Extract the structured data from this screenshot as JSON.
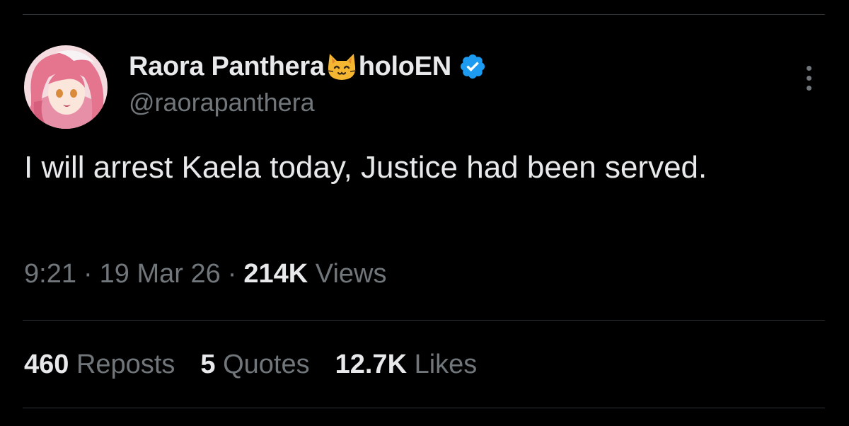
{
  "tweet": {
    "author": {
      "name_part1": "Raora Panthera",
      "emoji": "cat-face-emoji",
      "name_part2": "holoEN",
      "verified": true,
      "handle": "@raorapanthera",
      "avatar": "avatar-image"
    },
    "text": "I will arrest Kaela today, Justice had been served.",
    "meta": {
      "time": "9:21",
      "separator": "·",
      "date": "19 Mar 26",
      "views_count": "214K",
      "views_label": "Views"
    },
    "stats": [
      {
        "count": "460",
        "label": "Reposts"
      },
      {
        "count": "5",
        "label": "Quotes"
      },
      {
        "count": "12.7K",
        "label": "Likes"
      }
    ]
  },
  "colors": {
    "background": "#000000",
    "text_primary": "#e7e9ea",
    "text_secondary": "#71767b",
    "divider": "#2f3336",
    "verified_blue": "#1d9bf0"
  },
  "icons": {
    "more": "more-vertical-icon",
    "verified": "verified-badge-icon"
  }
}
